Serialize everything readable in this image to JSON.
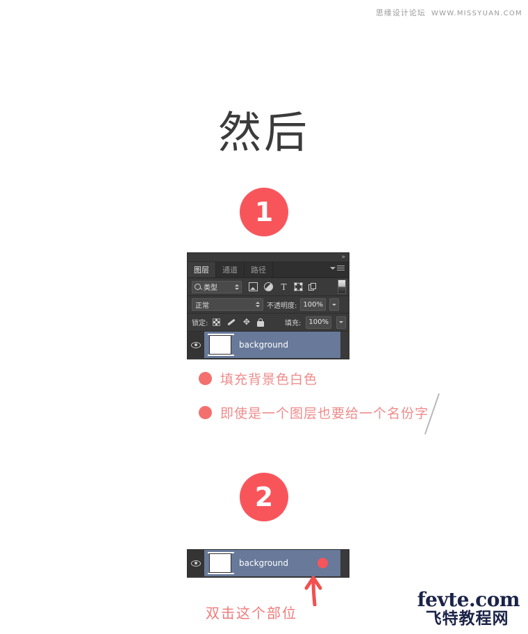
{
  "watermark": {
    "cn": "思缘设计论坛",
    "url": "WWW.MISSYUAN.COM"
  },
  "heading": "然后",
  "steps": {
    "one": "1",
    "two": "2"
  },
  "panel": {
    "collapse_icon": "»",
    "tabs": [
      {
        "label": "图层",
        "active": true
      },
      {
        "label": "通道",
        "active": false
      },
      {
        "label": "路径",
        "active": false
      }
    ],
    "filter_row": {
      "kind_label": "类型",
      "icons": [
        "pixel-filter-icon",
        "adjustment-filter-icon",
        "type-filter-icon",
        "shape-filter-icon",
        "smart-object-filter-icon"
      ],
      "type_glyph": "T"
    },
    "blend_row": {
      "blend_mode": "正常",
      "opacity_label": "不透明度:",
      "opacity_value": "100%"
    },
    "lock_row": {
      "lock_label": "锁定:",
      "move_glyph": "✥",
      "fill_label": "填充:",
      "fill_value": "100%"
    },
    "layer": {
      "name": "background"
    }
  },
  "panel2": {
    "layer": {
      "name": "background"
    }
  },
  "annotations": {
    "line1": "填充背景色白色",
    "line2": "即使是一个图层也要给一个名份字",
    "bottom": "双击这个部位"
  },
  "footer": {
    "en": "fevte.com",
    "cn": "飞特教程网"
  },
  "colors": {
    "accent_red": "#f8555b",
    "annotation_pink": "#ef8b8b",
    "panel_bg": "#333333",
    "layer_selected": "#68799a",
    "logo_navy": "#1b2348"
  }
}
